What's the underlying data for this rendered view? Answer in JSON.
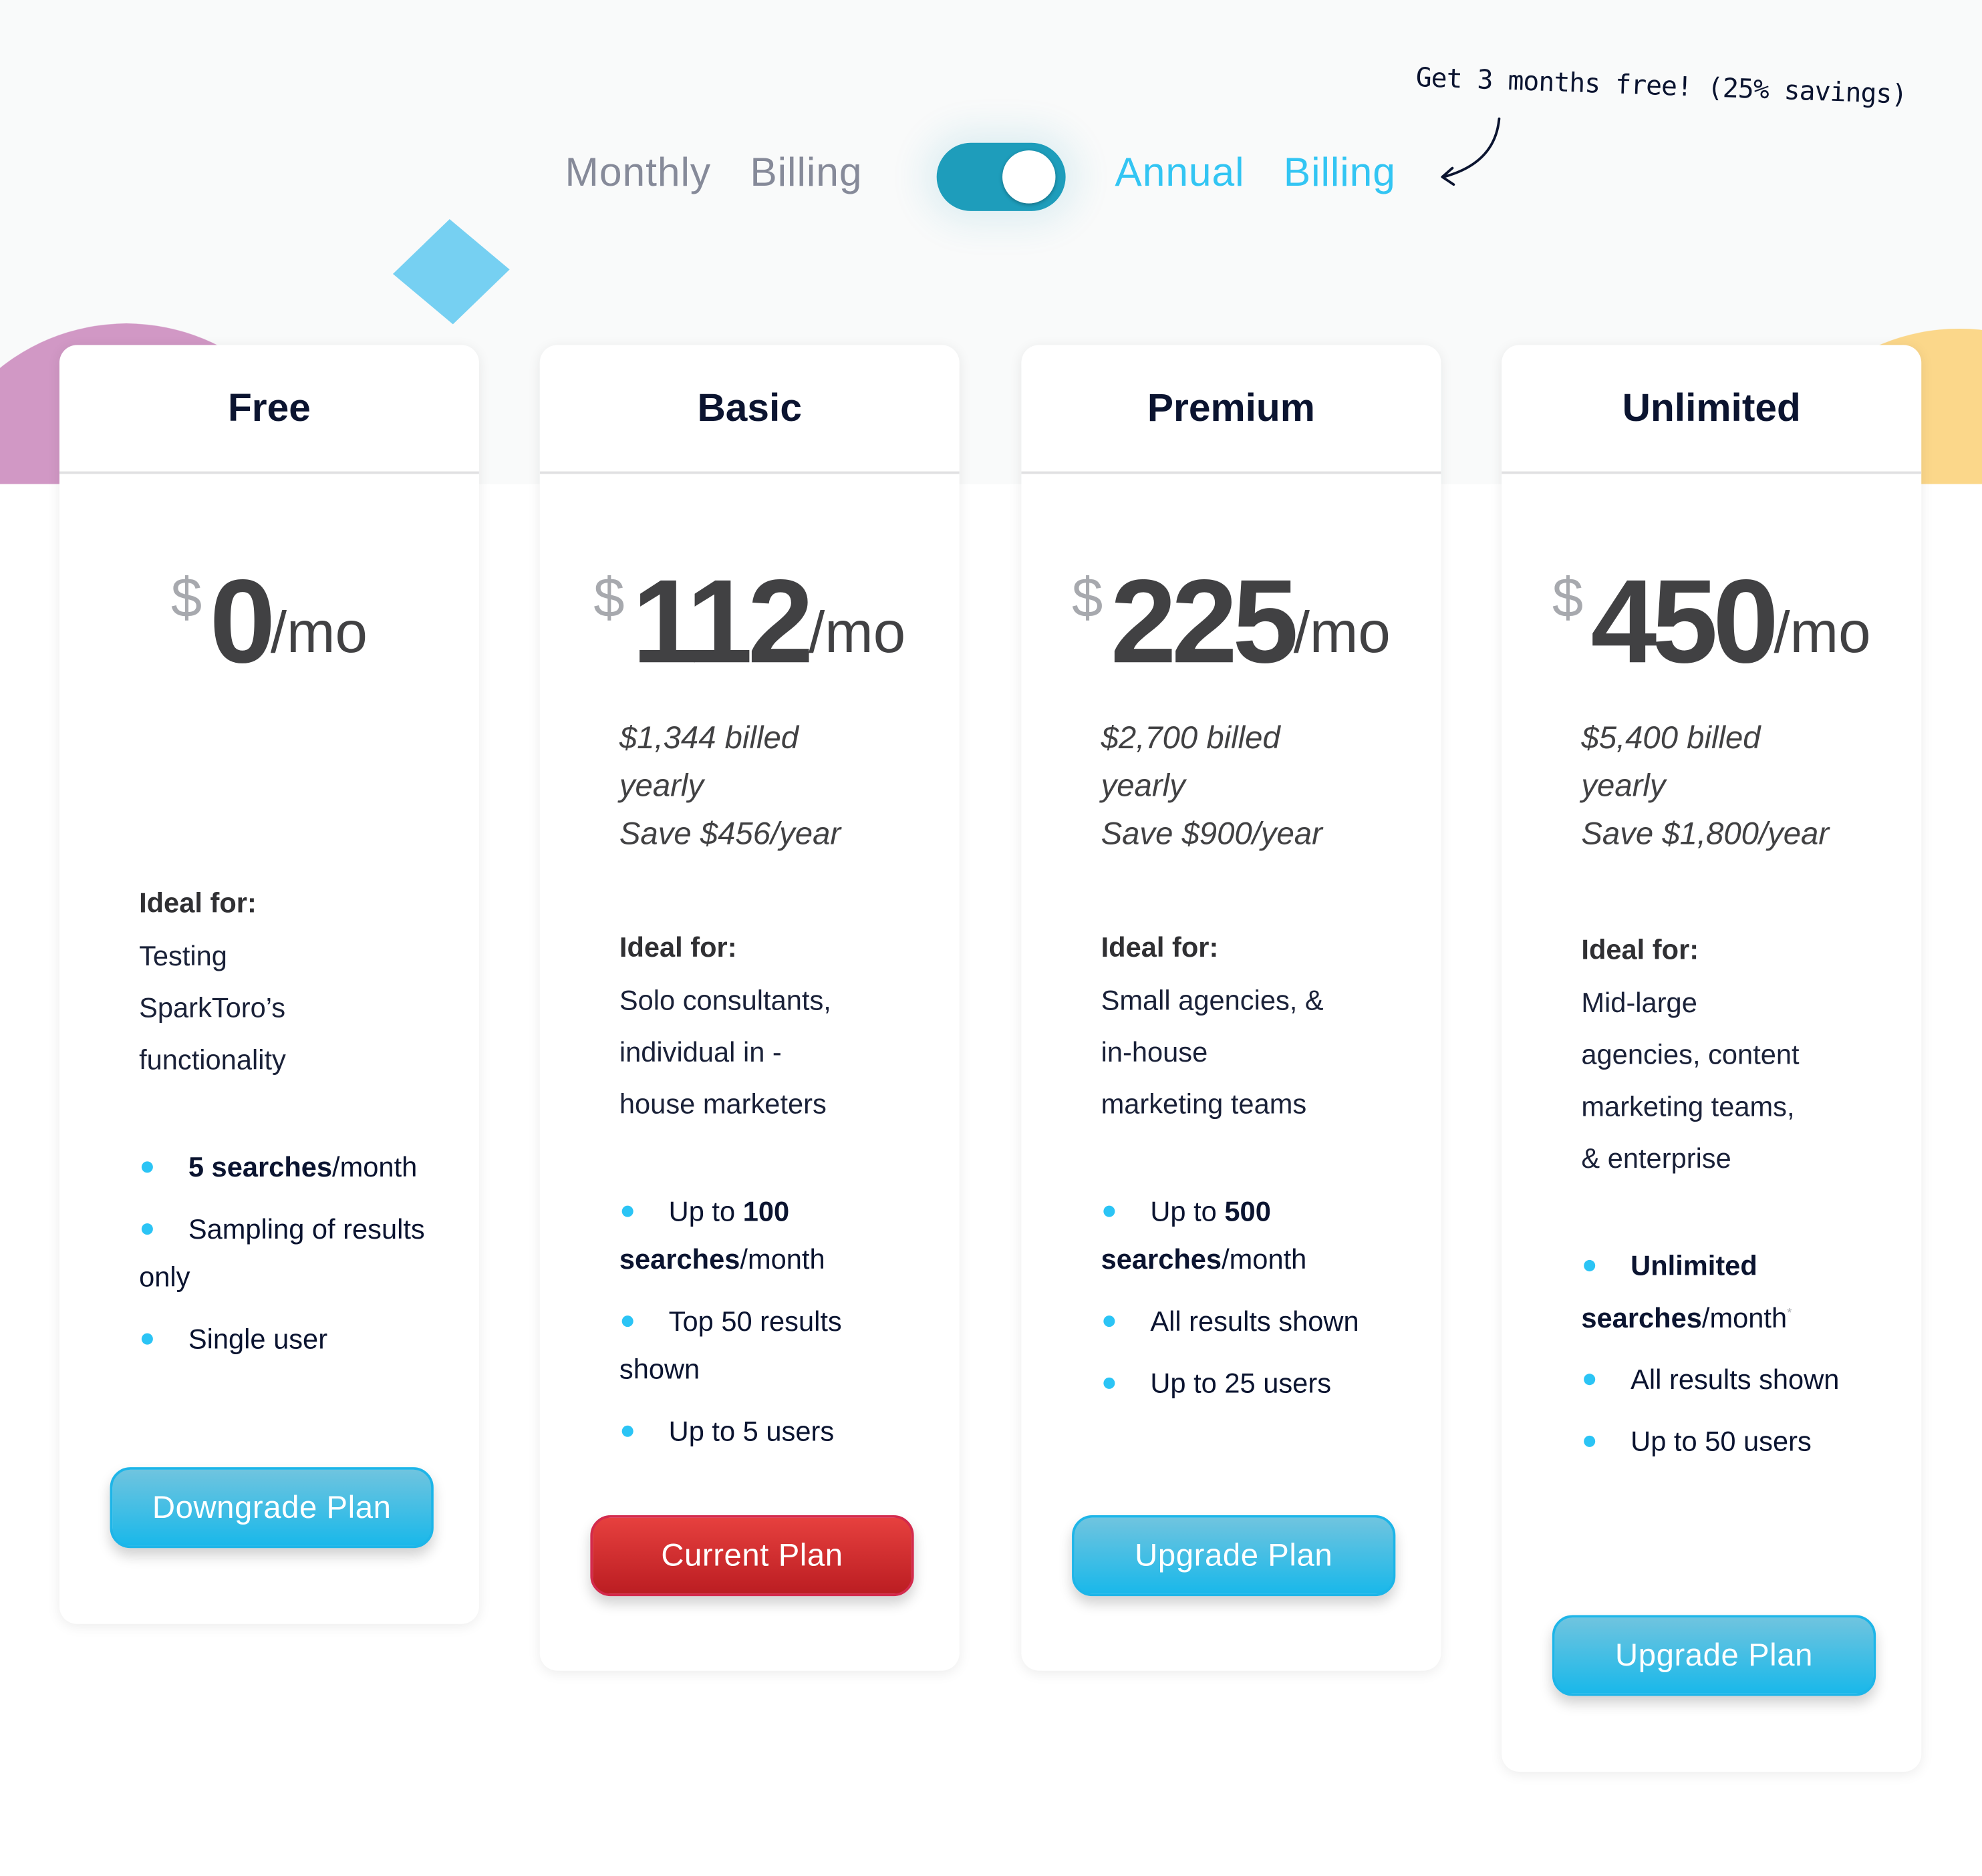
{
  "billing": {
    "monthly_label": "Monthly  Billing",
    "annual_label": "Annual  Billing",
    "toggle_state": "annual",
    "promo_text": "Get 3 months free! (25% savings)"
  },
  "ideal_heading": "Ideal for:",
  "colors": {
    "accent": "#33c5f3",
    "toggle": "#1e9dbb",
    "current_button": "#d32a2e",
    "action_button": "#19b8ea",
    "bullet": "#2bc4f5"
  },
  "plans": [
    {
      "name": "Free",
      "currency": "$",
      "amount": "0",
      "period": "/mo",
      "billed": [],
      "ideal_for": [
        "Testing",
        "SparkToro’s",
        "functionality"
      ],
      "features": [
        {
          "pre": "",
          "bold": "5 searches",
          "post": "/month"
        },
        {
          "pre": "Sampling of results only",
          "bold": "",
          "post": ""
        },
        {
          "pre": "Single user",
          "bold": "",
          "post": ""
        }
      ],
      "button": "Downgrade Plan",
      "button_style": "blue"
    },
    {
      "name": "Basic",
      "currency": "$",
      "amount": "112",
      "period": "/mo",
      "billed": [
        "$1,344 billed yearly",
        "Save $456/year"
      ],
      "ideal_for": [
        "Solo consultants,",
        "individual in -",
        "house marketers"
      ],
      "features": [
        {
          "pre": "Up to ",
          "bold": "100 searches",
          "post": "/month"
        },
        {
          "pre": "Top 50 results shown",
          "bold": "",
          "post": ""
        },
        {
          "pre": "Up to 5 users",
          "bold": "",
          "post": ""
        }
      ],
      "button": "Current Plan",
      "button_style": "red"
    },
    {
      "name": "Premium",
      "currency": "$",
      "amount": "225",
      "period": "/mo",
      "billed": [
        "$2,700 billed yearly",
        "Save $900/year"
      ],
      "ideal_for": [
        "Small agencies, &",
        "in-house",
        "marketing teams"
      ],
      "features": [
        {
          "pre": "Up to ",
          "bold": "500 searches",
          "post": "/month"
        },
        {
          "pre": "All results shown",
          "bold": "",
          "post": ""
        },
        {
          "pre": "Up to 25 users",
          "bold": "",
          "post": ""
        }
      ],
      "button": "Upgrade Plan",
      "button_style": "blue"
    },
    {
      "name": "Unlimited",
      "currency": "$",
      "amount": "450",
      "period": "/mo",
      "billed": [
        "$5,400 billed yearly",
        "Save $1,800/year"
      ],
      "ideal_for": [
        "Mid-large",
        "agencies, content",
        "marketing teams,",
        "& enterprise"
      ],
      "features": [
        {
          "pre": "",
          "bold": "Unlimited searches",
          "post": "/month",
          "footnote": "*"
        },
        {
          "pre": "All results shown",
          "bold": "",
          "post": ""
        },
        {
          "pre": "Up to 50 users",
          "bold": "",
          "post": ""
        }
      ],
      "button": "Upgrade Plan",
      "button_style": "blue"
    }
  ]
}
